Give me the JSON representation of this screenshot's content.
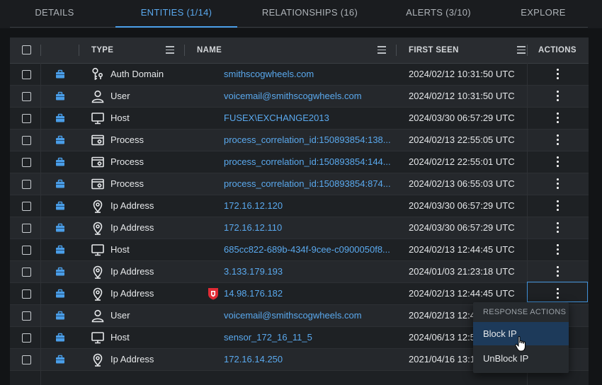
{
  "tabs": [
    {
      "label": "DETAILS",
      "active": false
    },
    {
      "label": "ENTITIES  (1/14)",
      "active": true
    },
    {
      "label": "RELATIONSHIPS  (16)",
      "active": false
    },
    {
      "label": "ALERTS  (3/10)",
      "active": false
    },
    {
      "label": "EXPLORE",
      "active": false
    }
  ],
  "table": {
    "columns": {
      "type": "TYPE",
      "name": "NAME",
      "first_seen": "FIRST SEEN",
      "actions": "ACTIONS"
    },
    "rows": [
      {
        "type": "Auth Domain",
        "icon": "key-person-icon",
        "name": "smithscogwheels.com",
        "first_seen": "2024/02/12 10:31:50 UTC"
      },
      {
        "type": "User",
        "icon": "user-icon",
        "name": "voicemail@smithscogwheels.com",
        "first_seen": "2024/02/12 10:31:50 UTC"
      },
      {
        "type": "Host",
        "icon": "monitor-icon",
        "name": "FUSEX\\EXCHANGE2013",
        "first_seen": "2024/03/30 06:57:29 UTC"
      },
      {
        "type": "Process",
        "icon": "process-icon",
        "name": "process_correlation_id:150893854:138...",
        "first_seen": "2024/02/13 22:55:05 UTC"
      },
      {
        "type": "Process",
        "icon": "process-icon",
        "name": "process_correlation_id:150893854:144...",
        "first_seen": "2024/02/12 22:55:01 UTC"
      },
      {
        "type": "Process",
        "icon": "process-icon",
        "name": "process_correlation_id:150893854:874...",
        "first_seen": "2024/02/13 06:55:03 UTC"
      },
      {
        "type": "Ip Address",
        "icon": "location-pin-icon",
        "name": "172.16.12.120",
        "first_seen": "2024/03/30 06:57:29 UTC"
      },
      {
        "type": "Ip Address",
        "icon": "location-pin-icon",
        "name": "172.16.12.110",
        "first_seen": "2024/03/30 06:57:29 UTC"
      },
      {
        "type": "Host",
        "icon": "monitor-icon",
        "name": "685cc822-689b-434f-9cee-c0900050f8...",
        "first_seen": "2024/02/13 12:44:45 UTC"
      },
      {
        "type": "Ip Address",
        "icon": "location-pin-icon",
        "name": "3.133.179.193",
        "first_seen": "2024/01/03 21:23:18 UTC"
      },
      {
        "type": "Ip Address",
        "icon": "location-pin-icon",
        "name": "14.98.176.182",
        "first_seen": "2024/02/13 12:44:45 UTC",
        "flagged": true
      },
      {
        "type": "User",
        "icon": "user-icon",
        "name": "voicemail@smithscogwheels.com",
        "first_seen": "2024/02/13 12:4"
      },
      {
        "type": "Host",
        "icon": "monitor-icon",
        "name": "sensor_172_16_11_5",
        "first_seen": "2024/06/13 12:5"
      },
      {
        "type": "Ip Address",
        "icon": "location-pin-icon",
        "name": "172.16.14.250",
        "first_seen": "2021/04/16 13:1"
      }
    ]
  },
  "response_menu": {
    "header": "RESPONSE ACTIONS",
    "items": [
      "Block IP",
      "UnBlock IP"
    ],
    "highlighted": "Block IP"
  },
  "colors": {
    "accent": "#4a9ee8",
    "link": "#5aa9ee",
    "threat": "#e02b35"
  }
}
